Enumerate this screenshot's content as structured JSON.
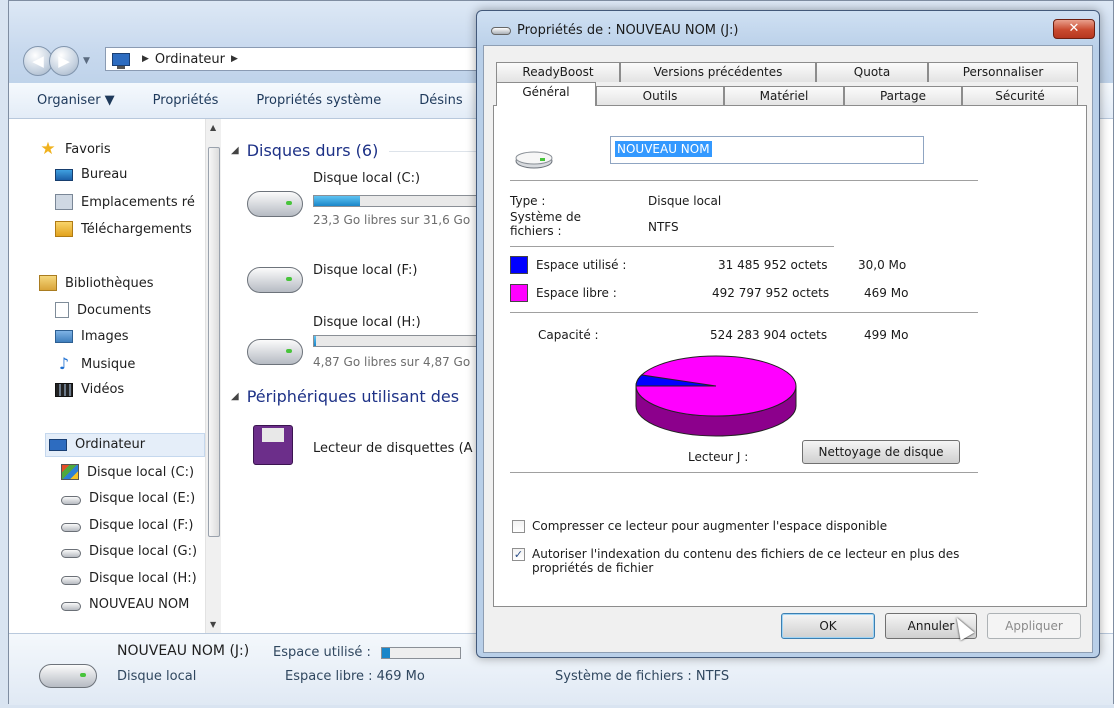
{
  "explorer": {
    "breadcrumb": "Ordinateur",
    "toolbar": [
      "Organiser ▼",
      "Propriétés",
      "Propriétés système",
      "Désins"
    ],
    "nav": {
      "favorites": "Favoris",
      "favorites_items": [
        "Bureau",
        "Emplacements ré",
        "Téléchargements"
      ],
      "libraries": "Bibliothèques",
      "libraries_items": [
        "Documents",
        "Images",
        "Musique",
        "Vidéos"
      ],
      "computer": "Ordinateur",
      "computer_items": [
        "Disque local (C:)",
        "Disque local (E:)",
        "Disque local (F:)",
        "Disque local (G:)",
        "Disque local (H:)",
        "NOUVEAU NOM"
      ]
    },
    "groups": {
      "hard_disks": "Disques durs (6)",
      "removable": "Périphériques utilisant des"
    },
    "drives": [
      {
        "name": "Disque local (C:)",
        "free": "23,3 Go libres sur 31,6 Go",
        "fill": 0.26
      },
      {
        "name": "Disque local (F:)",
        "free": "",
        "fill": null
      },
      {
        "name": "Disque local (H:)",
        "free": "4,87 Go libres sur 4,87 Go",
        "fill": 0.01
      }
    ],
    "floppy": "Lecteur de disquettes (A",
    "details": {
      "name": "NOUVEAU NOM (J:)",
      "type": "Disque local",
      "used_label": "Espace utilisé :",
      "free_label": "Espace libre : 469 Mo",
      "fs_label": "Système de fichiers : NTFS"
    }
  },
  "dialog": {
    "title": "Propriétés de : NOUVEAU NOM (J:)",
    "close": "✕",
    "tabs_row1": [
      "ReadyBoost",
      "Versions précédentes",
      "Quota",
      "Personnaliser"
    ],
    "tabs_row2": [
      "Général",
      "Outils",
      "Matériel",
      "Partage",
      "Sécurité"
    ],
    "volume_name": "NOUVEAU NOM",
    "type_label": "Type :",
    "type_value": "Disque local",
    "fs_label1": "Système de",
    "fs_label2": "fichiers :",
    "fs_value": "NTFS",
    "used_label": "Espace utilisé :",
    "used_bytes": "31 485 952 octets",
    "used_size": "30,0 Mo",
    "free_label": "Espace libre :",
    "free_bytes": "492 797 952 octets",
    "free_size": "469 Mo",
    "capacity_label": "Capacité :",
    "capacity_bytes": "524 283 904 octets",
    "capacity_size": "499 Mo",
    "drive_label": "Lecteur J :",
    "cleanup_button": "Nettoyage de disque",
    "compress_label": "Compresser ce lecteur pour augmenter l'espace disponible",
    "compress_checked": false,
    "index_label1": "Autoriser l'indexation du contenu des fichiers de ce lecteur en plus des",
    "index_label2": "propriétés de fichier",
    "index_checked": true,
    "ok": "OK",
    "cancel": "Annuler",
    "apply": "Appliquer",
    "colors": {
      "used": "#0000ff",
      "free": "#ff00ff"
    },
    "used_fraction": 0.06
  }
}
